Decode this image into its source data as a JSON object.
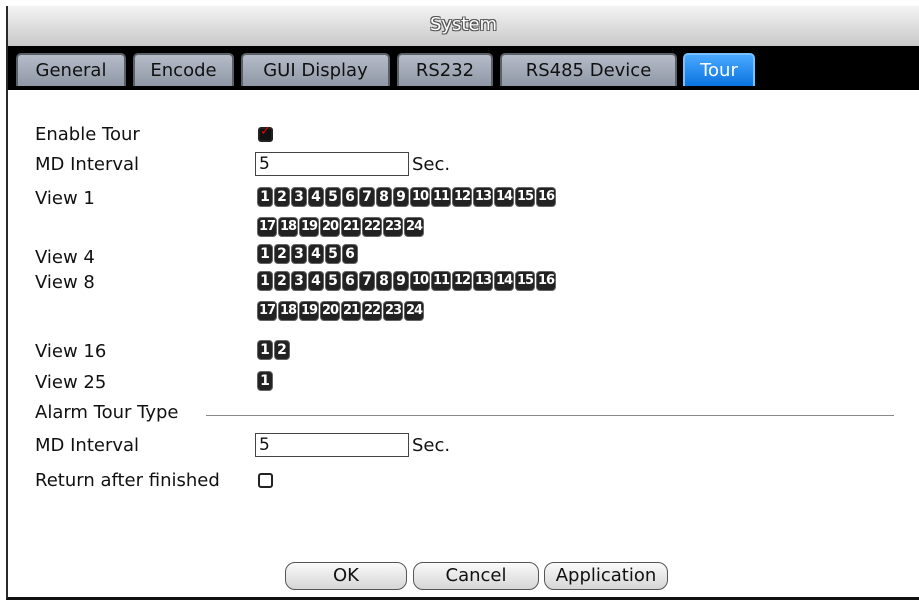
{
  "window": {
    "title": "System"
  },
  "tabs": [
    {
      "label": "General"
    },
    {
      "label": "Encode"
    },
    {
      "label": "GUI Display"
    },
    {
      "label": "RS232"
    },
    {
      "label": "RS485 Device"
    },
    {
      "label": "Tour",
      "active": true
    }
  ],
  "form": {
    "enable_tour": {
      "label": "Enable Tour",
      "checked": true
    },
    "md_interval": {
      "label": "MD Interval",
      "value": "5",
      "unit": "Sec."
    },
    "view1": {
      "label": "View 1",
      "channels": [
        "1",
        "2",
        "3",
        "4",
        "5",
        "6",
        "7",
        "8",
        "9",
        "10",
        "11",
        "12",
        "13",
        "14",
        "15",
        "16",
        "17",
        "18",
        "19",
        "20",
        "21",
        "22",
        "23",
        "24"
      ]
    },
    "view4": {
      "label": "View 4",
      "channels": [
        "1",
        "2",
        "3",
        "4",
        "5",
        "6"
      ]
    },
    "view8": {
      "label": "View 8",
      "channels": [
        "1",
        "2",
        "3",
        "4",
        "5",
        "6",
        "7",
        "8",
        "9",
        "10",
        "11",
        "12",
        "13",
        "14",
        "15",
        "16",
        "17",
        "18",
        "19",
        "20",
        "21",
        "22",
        "23",
        "24"
      ]
    },
    "view16": {
      "label": "View 16",
      "channels": [
        "1",
        "2"
      ]
    },
    "view25": {
      "label": "View 25",
      "channels": [
        "1"
      ]
    },
    "alarm_tour_type": {
      "label": "Alarm Tour Type"
    },
    "alarm_md_interval": {
      "label": "MD Interval",
      "value": "5",
      "unit": "Sec."
    },
    "return_after_finished": {
      "label": "Return after finished",
      "checked": false
    }
  },
  "buttons": {
    "ok": "OK",
    "cancel": "Cancel",
    "application": "Application"
  }
}
